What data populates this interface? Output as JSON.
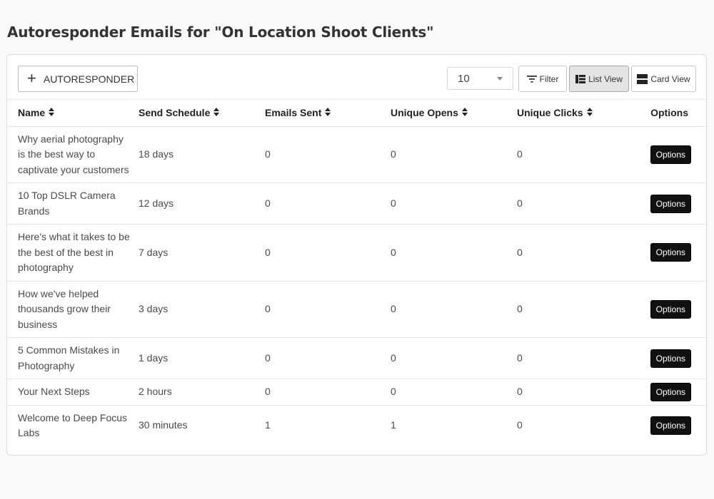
{
  "page": {
    "title": "Autoresponder Emails for \"On Location Shoot Clients\""
  },
  "toolbar": {
    "add_label": "AUTORESPONDER",
    "page_size": "10",
    "filter_label": "Filter",
    "list_view_label": "List View",
    "card_view_label": "Card View",
    "active_view": "List View"
  },
  "table": {
    "headers": {
      "name": "Name",
      "schedule": "Send Schedule",
      "sent": "Emails Sent",
      "opens": "Unique Opens",
      "clicks": "Unique Clicks",
      "options": "Options"
    },
    "option_label": "Options",
    "rows": [
      {
        "name": "Why aerial photography is the best way to captivate your customers",
        "schedule": "18 days",
        "sent": "0",
        "opens": "0",
        "clicks": "0"
      },
      {
        "name": "10 Top DSLR Camera Brands",
        "schedule": "12 days",
        "sent": "0",
        "opens": "0",
        "clicks": "0"
      },
      {
        "name": "Here's what it takes to be the best of the best in photography",
        "schedule": "7 days",
        "sent": "0",
        "opens": "0",
        "clicks": "0"
      },
      {
        "name": "How we've helped thousands grow their business",
        "schedule": "3 days",
        "sent": "0",
        "opens": "0",
        "clicks": "0"
      },
      {
        "name": "5 Common Mistakes in Photography",
        "schedule": "1 days",
        "sent": "0",
        "opens": "0",
        "clicks": "0"
      },
      {
        "name": "Your Next Steps",
        "schedule": "2 hours",
        "sent": "0",
        "opens": "0",
        "clicks": "0"
      },
      {
        "name": "Welcome to Deep Focus Labs",
        "schedule": "30 minutes",
        "sent": "1",
        "opens": "1",
        "clicks": "0"
      }
    ]
  },
  "colors": {
    "option_button_bg": "#111111",
    "active_view_bg": "#e4e4e4"
  },
  "icons": {
    "add": "plus-icon",
    "filter": "filter-icon",
    "list": "list-view-icon",
    "card": "card-view-icon",
    "sort": "sort-icon",
    "dropdown": "chevron-down-icon"
  }
}
